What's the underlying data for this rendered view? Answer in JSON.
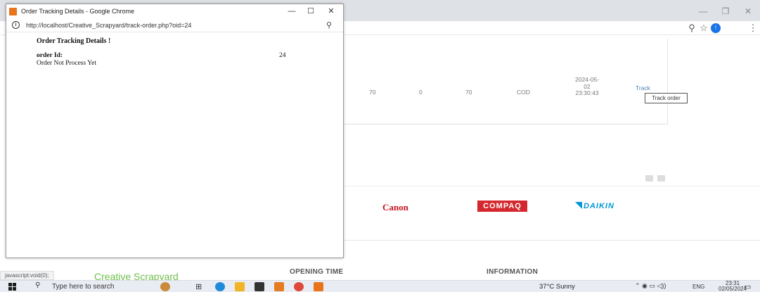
{
  "popup": {
    "title": "Order Tracking Details - Google Chrome",
    "url": "http://localhost/Creative_Scrapyard/track-order.php?oid=24",
    "heading": "Order Tracking Details !",
    "order_label": "order Id:",
    "order_value": "24",
    "status": "Order Not Process Yet"
  },
  "order_row": {
    "c1": "70",
    "c2": "0",
    "c3": "70",
    "payment": "COD",
    "date_l1": "2024-05-",
    "date_l2": "02",
    "date_l3": "23:30:43",
    "action": "Track",
    "tooltip": "Track order"
  },
  "brands": {
    "canon": "Canon",
    "compaq": "COMPAQ",
    "daikin": "DAIKIN"
  },
  "footer": {
    "opening_time": "OPENING TIME",
    "information": "INFORMATION",
    "site_name": "Creative Scrapyard",
    "status_link": "javascript:void(0);"
  },
  "taskbar": {
    "search_placeholder": "Type here to search",
    "weather": "37°C  Sunny",
    "lang": "ENG",
    "time": "23:31",
    "date": "02/05/2024"
  },
  "colors": {
    "canon": "#c8141e",
    "compaq": "#d5282e",
    "daikin": "#0097d7",
    "link": "#4a7fb5"
  }
}
